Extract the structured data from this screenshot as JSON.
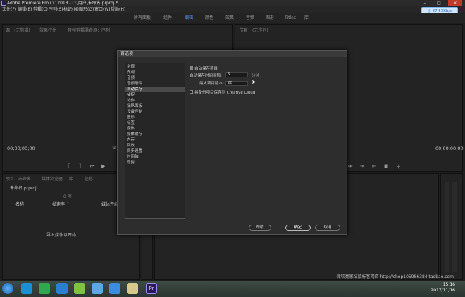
{
  "titlebar": {
    "title": "Adobe Premiere Pro CC 2018 - C:\\用户\\未命名.prproj *"
  },
  "menubar": {
    "items": [
      "文件(F)",
      "编辑(E)",
      "剪辑(C)",
      "序列(S)",
      "标记(M)",
      "图形(G)",
      "窗口(W)",
      "帮助(H)"
    ]
  },
  "workspace_tabs": {
    "items": [
      "所有面板",
      "组件",
      "编辑",
      "颜色",
      "效果",
      "音频",
      "图形",
      "Titles",
      "库"
    ],
    "active": "编辑"
  },
  "cloud": {
    "label": "◎ 87 53Kb/s"
  },
  "source_panel": {
    "tabs": [
      "源：(无剪辑)",
      "效果控件",
      "音频剪辑混合器：序列"
    ],
    "timecode": "00;00;00;00"
  },
  "program_panel": {
    "tabs": [
      "节目：(无序列)"
    ],
    "timecode": "00;00;00;00"
  },
  "project_panel": {
    "tabs": [
      "项目：未命名",
      "媒体浏览器",
      "库",
      "信息"
    ],
    "file": "未命名.prproj",
    "items_count": "0 项",
    "col_name": "名称",
    "col_fps": "帧速率 ^",
    "col_media_start": "媒体开始",
    "empty_hint": "导入媒体以开始"
  },
  "dialog": {
    "title": "首选项",
    "categories": [
      "常规",
      "外观",
      "音频",
      "音频硬件",
      "自动保存",
      "捕捉",
      "协作",
      "操纵面板",
      "设备控制",
      "图形",
      "标签",
      "媒体",
      "媒体缓存",
      "内存",
      "回放",
      "同步设置",
      "时间轴",
      "修剪"
    ],
    "selected_index": 4,
    "options": {
      "autosave_label": "自动保存项目",
      "autosave_checked": true,
      "interval_label": "自动保存时间间隔:",
      "interval_value": "5",
      "interval_unit": "分钟",
      "max_versions_label": "最大项目版本:",
      "max_versions_value": "20",
      "cloud_label": "将备份项目保存到 Creative Cloud",
      "cloud_checked": false
    },
    "buttons": {
      "help": "帮助",
      "ok": "确定",
      "cancel": "取消"
    }
  },
  "taskbar": {
    "time": "15:16",
    "date": "2017/11/16",
    "watermark": "微软亮家炫鼠标客网店 http://shop105986384.taobao.com"
  }
}
